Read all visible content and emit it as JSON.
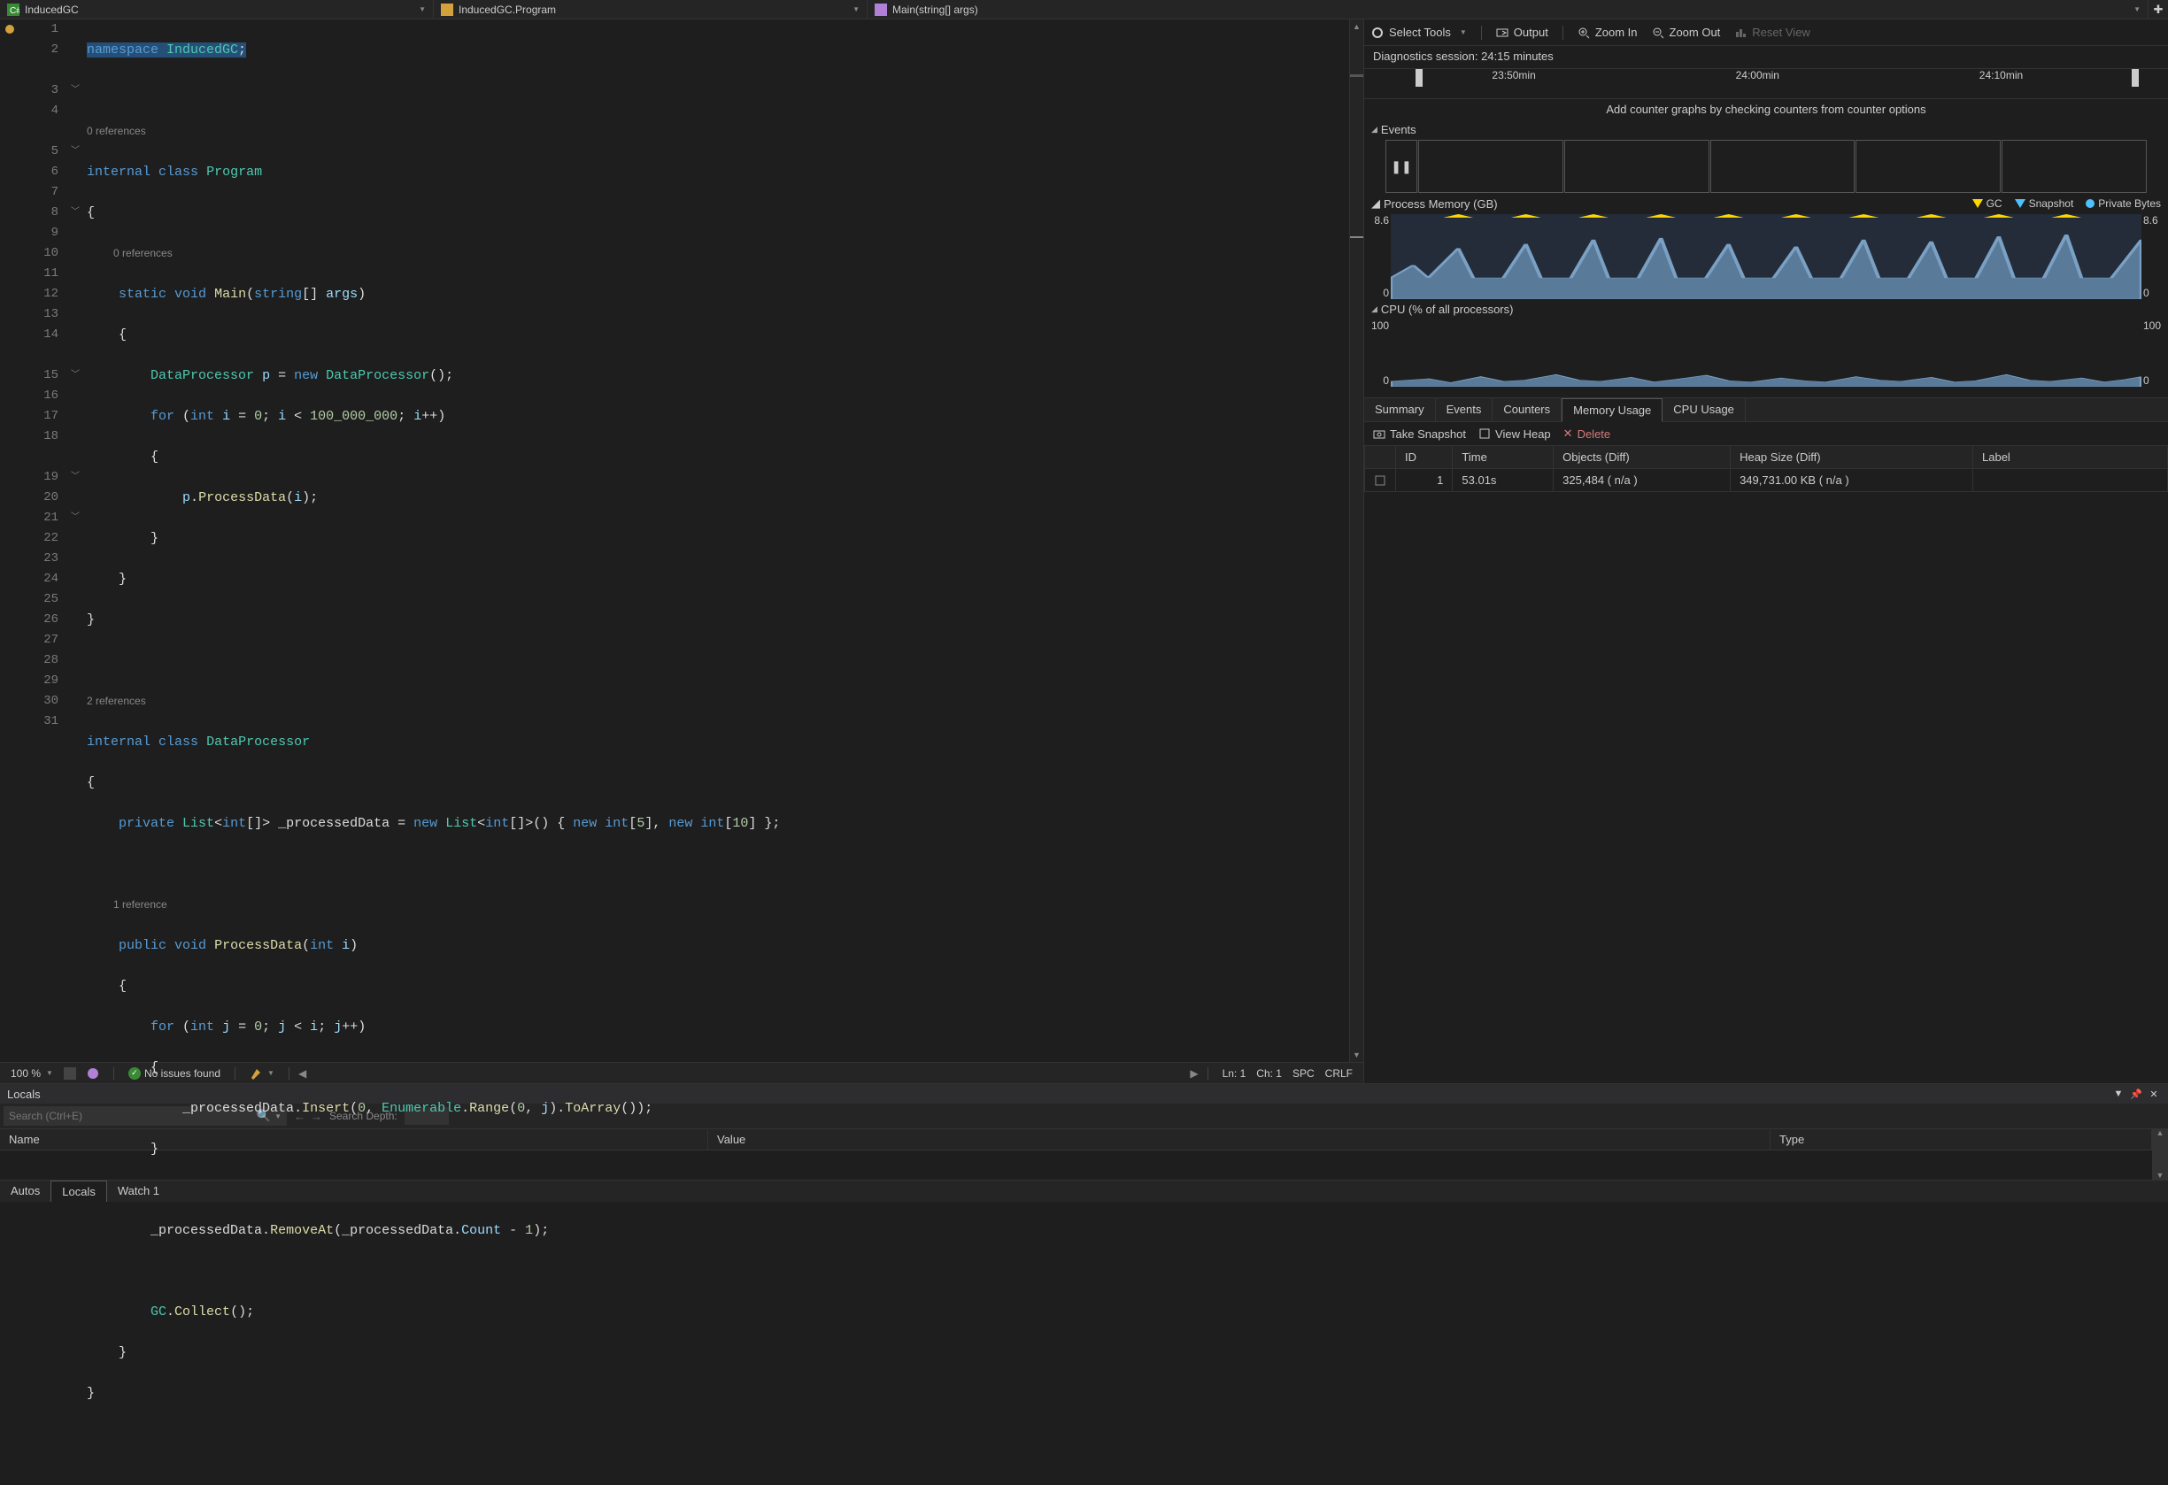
{
  "topbar": {
    "file": "InducedGC",
    "class": "InducedGC.Program",
    "method": "Main(string[] args)"
  },
  "editor": {
    "zoom": "100 %",
    "issues": "No issues found",
    "cursor_ln": "Ln: 1",
    "cursor_ch": "Ch: 1",
    "ws": "SPC",
    "eol": "CRLF",
    "codelens": {
      "program": "0 references",
      "main": "0 references",
      "dataprocessor": "2 references",
      "processdata": "1 reference"
    }
  },
  "diag": {
    "toolbar": {
      "select": "Select Tools",
      "output": "Output",
      "zoomin": "Zoom In",
      "zoomout": "Zoom Out",
      "reset": "Reset View"
    },
    "session": "Diagnostics session: 24:15 minutes",
    "timeline": [
      "23:50min",
      "24:00min",
      "24:10min"
    ],
    "counter_hint": "Add counter graphs by checking counters from counter options",
    "events_hdr": "Events",
    "mem_hdr": "Process Memory (GB)",
    "cpu_hdr": "CPU (% of all processors)",
    "legend": {
      "gc": "GC",
      "snapshot": "Snapshot",
      "priv": "Private Bytes"
    },
    "mem_y": {
      "max": "8.6",
      "min": "0"
    },
    "cpu_y": {
      "max": "100",
      "min": "0"
    },
    "tabs": [
      "Summary",
      "Events",
      "Counters",
      "Memory Usage",
      "CPU Usage"
    ],
    "active_tab": 3,
    "mem_toolbar": {
      "take": "Take Snapshot",
      "view": "View Heap",
      "del": "Delete"
    },
    "mem_cols": [
      "ID",
      "Time",
      "Objects (Diff)",
      "Heap Size (Diff)",
      "Label"
    ],
    "mem_rows": [
      {
        "id": "1",
        "time": "53.01s",
        "objects": "325,484  ( n/a )",
        "heap": "349,731.00 KB  ( n/a )",
        "label": ""
      }
    ]
  },
  "locals": {
    "title": "Locals",
    "search_ph": "Search (Ctrl+E)",
    "depth_lbl": "Search Depth:",
    "cols": {
      "name": "Name",
      "value": "Value",
      "type": "Type"
    },
    "tabs": [
      "Autos",
      "Locals",
      "Watch 1"
    ],
    "active_tab": 1
  },
  "chart_data": [
    {
      "type": "area",
      "name": "Process Memory (GB)",
      "ylim": [
        0,
        8.6
      ],
      "xrange": "23:45–24:15",
      "series": [
        {
          "name": "Private Bytes",
          "values": [
            1.8,
            2.8,
            1.9,
            4.2,
            2.0,
            1.9,
            4.8,
            2.0,
            2.0,
            5.2,
            2.1,
            2.0,
            5.6,
            2.1,
            2.0,
            5.0,
            2.0,
            1.9,
            4.6,
            2.0,
            1.9,
            5.4,
            2.1,
            2.0,
            5.2,
            2.0,
            2.0,
            5.8,
            2.1,
            2.0,
            6.0
          ]
        }
      ],
      "markers": {
        "GC": 10,
        "Snapshot": 1
      }
    },
    {
      "type": "area",
      "name": "CPU (% of all processors)",
      "ylim": [
        0,
        100
      ],
      "xrange": "23:45–24:15",
      "series": [
        {
          "name": "CPU",
          "values": [
            5,
            8,
            4,
            10,
            6,
            5,
            12,
            7,
            6,
            9,
            5,
            7,
            11,
            6,
            5,
            8,
            6,
            5,
            10,
            7,
            6,
            9,
            5,
            6,
            12,
            7,
            6,
            8,
            5,
            7,
            10
          ]
        }
      ]
    }
  ]
}
